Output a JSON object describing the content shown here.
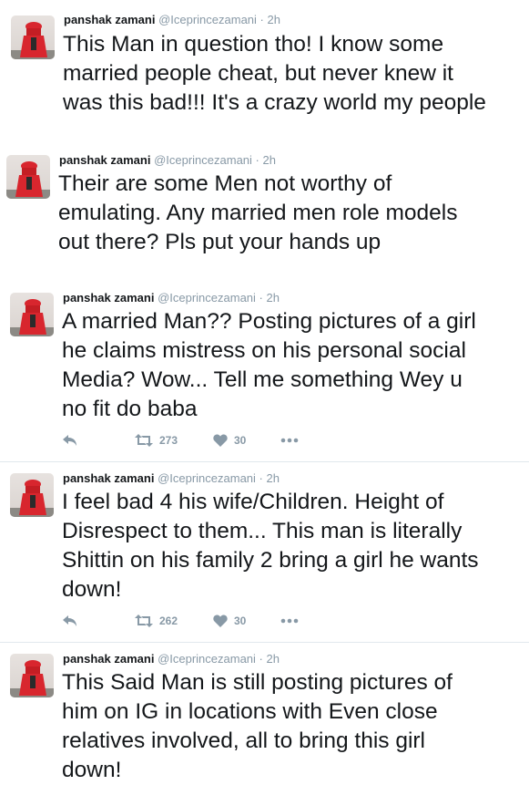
{
  "colors": {
    "text": "#14171a",
    "meta": "#8899a6",
    "divider": "#e1e8ed",
    "avatar_red": "#d8262e"
  },
  "tweets": [
    {
      "name": "panshak zamani",
      "handle": "@Iceprincezamani",
      "dot": "·",
      "time": "2h",
      "lines": [
        "This Man in question tho! I know some",
        "married people cheat, but never knew it",
        "was this bad!!! It's a crazy world my people"
      ]
    },
    {
      "name": "panshak zamani",
      "handle": "@Iceprincezamani",
      "dot": "·",
      "time": "2h",
      "lines": [
        "Their are some Men not worthy of",
        "emulating. Any married men role models",
        "out there? Pls put your hands up"
      ]
    },
    {
      "name": "panshak zamani",
      "handle": "@Iceprincezamani",
      "dot": "·",
      "time": "2h",
      "lines": [
        "A married Man?? Posting pictures of a girl",
        "he claims mistress on his personal social",
        "Media? Wow... Tell me something Wey u",
        "no fit do baba"
      ],
      "retweets": "273",
      "likes": "30"
    },
    {
      "name": "panshak zamani",
      "handle": "@Iceprincezamani",
      "dot": "·",
      "time": "2h",
      "lines": [
        "I feel bad 4 his wife/Children. Height of",
        "Disrespect to them... This man is literally",
        "Shittin on his family 2 bring a girl he wants",
        "down!"
      ],
      "retweets": "262",
      "likes": "30"
    },
    {
      "name": "panshak zamani",
      "handle": "@Iceprincezamani",
      "dot": "·",
      "time": "2h",
      "lines": [
        "This Said Man is still posting pictures of",
        "him on IG in locations with Even close",
        "relatives involved, all to bring this girl",
        "down!"
      ]
    }
  ]
}
